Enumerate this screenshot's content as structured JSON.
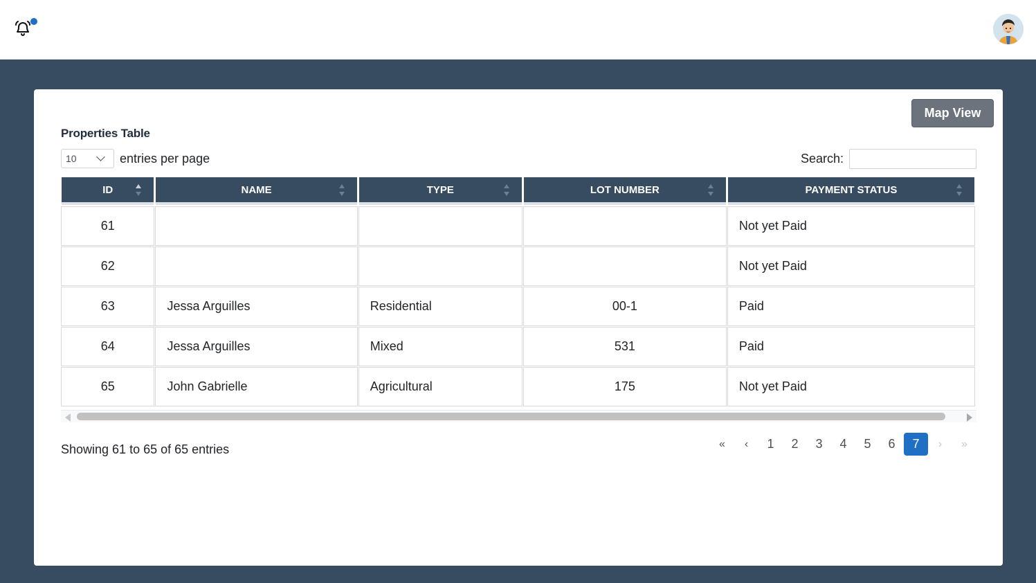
{
  "colors": {
    "notification_dot": "#1f6fc5",
    "accent": "#1f6fc5",
    "map_button": "#6c737c",
    "header_bg": "#374b61"
  },
  "topbar": {
    "bell_icon": "bell-ring-icon",
    "avatar_icon": "user-avatar-icon"
  },
  "card": {
    "map_view_label": "Map View",
    "table_title": "Properties Table",
    "entries": {
      "selected": "10",
      "label": "entries per page"
    },
    "search": {
      "label": "Search:",
      "value": ""
    },
    "columns": [
      "ID",
      "NAME",
      "TYPE",
      "LOT NUMBER",
      "PAYMENT STATUS"
    ],
    "rows": [
      {
        "id": "61",
        "name": "",
        "type": "",
        "lot": "",
        "payment": "Not yet Paid"
      },
      {
        "id": "62",
        "name": "",
        "type": "",
        "lot": "",
        "payment": "Not yet Paid"
      },
      {
        "id": "63",
        "name": "Jessa Arguilles",
        "type": "Residential",
        "lot": "00-1",
        "payment": "Paid"
      },
      {
        "id": "64",
        "name": "Jessa Arguilles",
        "type": "Mixed",
        "lot": "531",
        "payment": "Paid"
      },
      {
        "id": "65",
        "name": "John Gabrielle",
        "type": "Agricultural",
        "lot": "175",
        "payment": "Not yet Paid"
      }
    ],
    "showing": "Showing 61 to 65 of 65 entries",
    "pagination": {
      "first": "«",
      "prev": "‹",
      "pages": [
        "1",
        "2",
        "3",
        "4",
        "5",
        "6",
        "7"
      ],
      "current": "7",
      "next": "›",
      "last": "»"
    }
  }
}
